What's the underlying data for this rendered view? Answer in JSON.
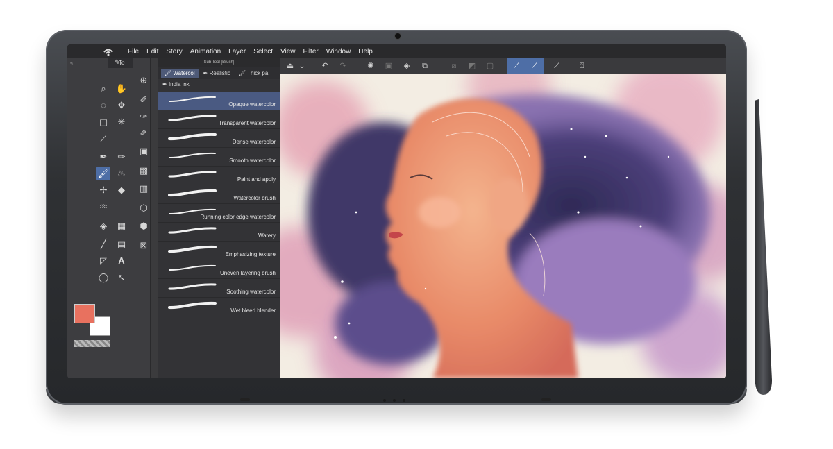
{
  "menu": {
    "items": [
      "File",
      "Edit",
      "Story",
      "Animation",
      "Layer",
      "Select",
      "View",
      "Filter",
      "Window",
      "Help"
    ]
  },
  "tool_panel": {
    "tab_label": "To",
    "icons": [
      "pointer-icon",
      "zoom-icon",
      "hand-icon",
      "lasso-icon",
      "move-icon",
      "select-rect-icon",
      "sparkle-icon",
      "eyedropper-icon",
      "pen-icon",
      "pencil-icon",
      "brush-icon",
      "ink-icon",
      "airbrush-icon",
      "eraser-icon",
      "blend-icon",
      "fill-icon",
      "gradient-icon",
      "line-icon",
      "frame-icon",
      "figure-icon",
      "text-icon",
      "balloon-icon",
      "correct-line-icon"
    ]
  },
  "colors": {
    "main": "#e8715f",
    "sub": "#ffffff",
    "accent": "#4e6ea6"
  },
  "sub_tool": {
    "title": "Sub Tool [Brush]",
    "tabs": [
      "Watercol",
      "Realistic",
      "Thick pa"
    ],
    "second_tab": "India ink",
    "brushes": [
      "Opaque watercolor",
      "Transparent watercolor",
      "Dense watercolor",
      "Smooth watercolor",
      "Paint and apply",
      "Watercolor brush",
      "Running color edge watercolor",
      "Watery",
      "Emphasizing texture",
      "Uneven layering brush",
      "Soothing watercolor",
      "Wet bleed blender"
    ]
  },
  "canvas_toolbar": {
    "icons": [
      "menu-icon",
      "chevron-down-icon",
      "undo-icon",
      "redo-icon",
      "loading-icon",
      "clear-icon",
      "fill-icon",
      "transform-icon",
      "deselect-icon",
      "invert-icon",
      "crop-icon",
      "snap-ruler-icon",
      "snap-special-icon",
      "snap-grid-icon",
      "help-icon"
    ]
  }
}
